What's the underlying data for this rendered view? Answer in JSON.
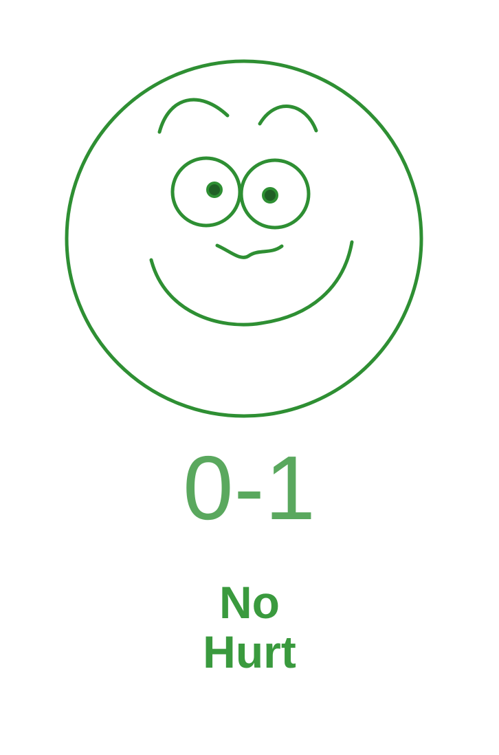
{
  "face": {
    "icon": "smiling-face-icon",
    "stroke_color": "#2e8f33"
  },
  "score_text": "0-1",
  "score_color": "#5aa85e",
  "label": {
    "line1": "No",
    "line2": "Hurt",
    "color": "#3a9a3e"
  }
}
